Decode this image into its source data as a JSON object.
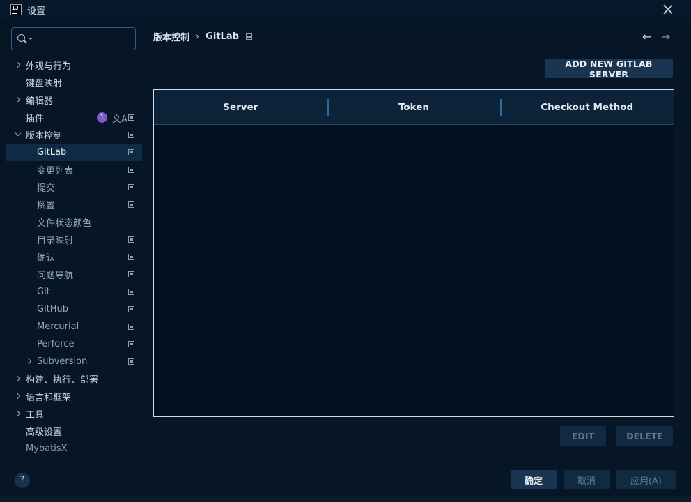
{
  "window": {
    "title": "设置"
  },
  "search": {
    "value": "",
    "placeholder": ""
  },
  "sidebar": {
    "items": [
      {
        "label": "外观与行为",
        "level": 0,
        "chevron": "right"
      },
      {
        "label": "键盘映射",
        "level": 0
      },
      {
        "label": "编辑器",
        "level": 0,
        "chevron": "right"
      },
      {
        "label": "插件",
        "level": 0,
        "badge": "1",
        "translate_icon": "文A",
        "square_icon": true
      },
      {
        "label": "版本控制",
        "level": 0,
        "chevron": "down",
        "square_icon": true
      },
      {
        "label": "GitLab",
        "level": 1,
        "selected": true,
        "square_icon": true
      },
      {
        "label": "变更列表",
        "level": 1,
        "square_icon": true
      },
      {
        "label": "提交",
        "level": 1,
        "square_icon": true
      },
      {
        "label": "搁置",
        "level": 1,
        "square_icon": true
      },
      {
        "label": "文件状态颜色",
        "level": 1
      },
      {
        "label": "目录映射",
        "level": 1,
        "square_icon": true
      },
      {
        "label": "确认",
        "level": 1,
        "square_icon": true
      },
      {
        "label": "问题导航",
        "level": 1,
        "square_icon": true
      },
      {
        "label": "Git",
        "level": 1,
        "square_icon": true
      },
      {
        "label": "GitHub",
        "level": 1,
        "square_icon": true
      },
      {
        "label": "Mercurial",
        "level": 1,
        "square_icon": true
      },
      {
        "label": "Perforce",
        "level": 1,
        "square_icon": true
      },
      {
        "label": "Subversion",
        "level": 1,
        "chevron": "right",
        "square_icon": true
      },
      {
        "label": "构建、执行、部署",
        "level": 0,
        "chevron": "right"
      },
      {
        "label": "语言和框架",
        "level": 0,
        "chevron": "right"
      },
      {
        "label": "工具",
        "level": 0,
        "chevron": "right"
      },
      {
        "label": "高级设置",
        "level": 0
      },
      {
        "label": "MybatisX",
        "level": 0,
        "muted": true
      }
    ]
  },
  "breadcrumb": {
    "parent": "版本控制",
    "separator": "›",
    "current": "GitLab"
  },
  "nav": {
    "back": "←",
    "forward": "→"
  },
  "toolbar": {
    "add_label": "ADD NEW GITLAB SERVER"
  },
  "table": {
    "columns": [
      "Server",
      "Token",
      "Checkout Method"
    ],
    "rows": []
  },
  "row_actions": {
    "edit_label": "EDIT",
    "delete_label": "DELETE"
  },
  "footer": {
    "help": "?",
    "ok_label": "确定",
    "cancel_label": "取消",
    "apply_label": "应用(A)"
  },
  "colors": {
    "background": "#061626",
    "primary_button": "#1a3551",
    "badge": "#7b5bc6",
    "selected_row": "#0f2a45"
  }
}
